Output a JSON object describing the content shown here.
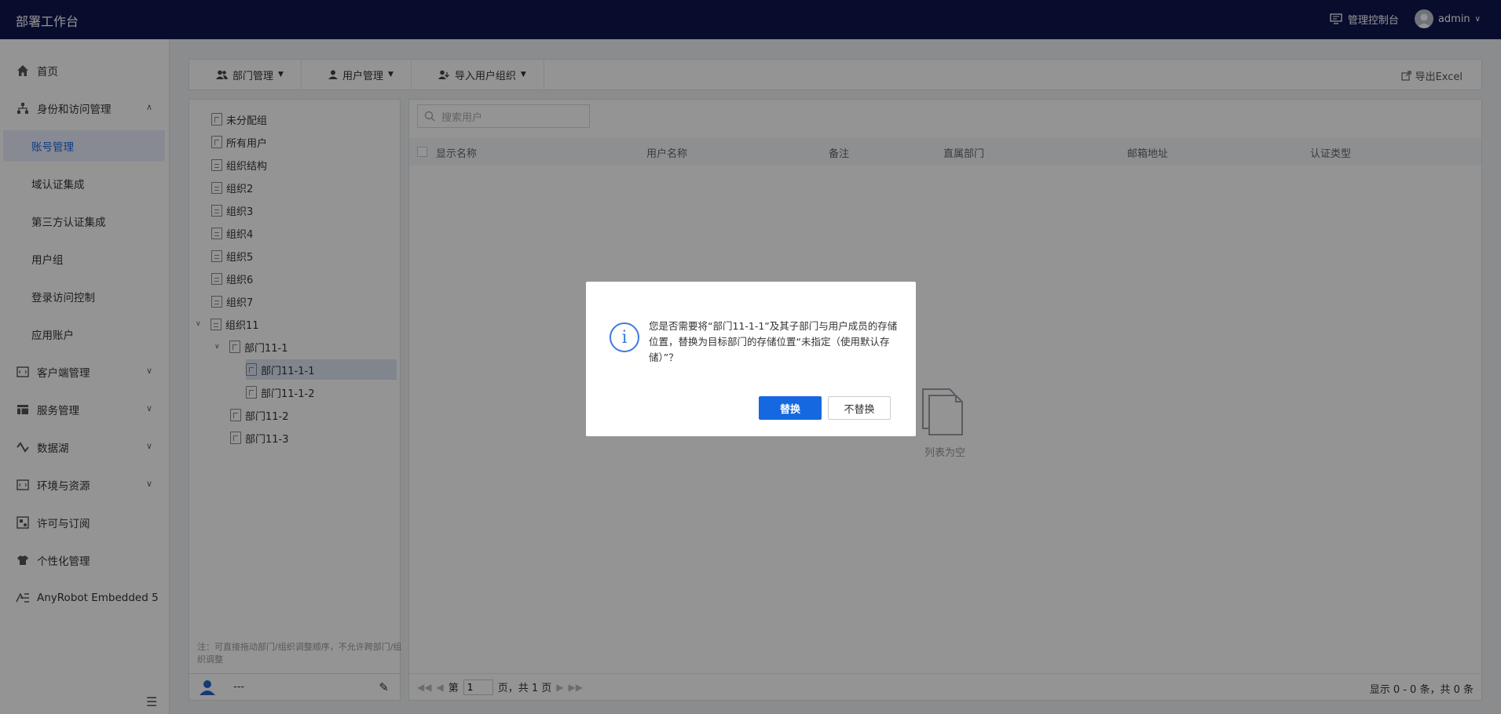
{
  "header": {
    "title": "部署工作台",
    "console_label": "管理控制台",
    "user_name": "admin"
  },
  "sidebar": {
    "items": [
      {
        "label": "首页",
        "icon": "home-icon"
      },
      {
        "label": "身份和访问管理",
        "icon": "org-icon",
        "expanded": true
      },
      {
        "label": "账号管理",
        "sub": true,
        "active": true
      },
      {
        "label": "域认证集成",
        "sub": true
      },
      {
        "label": "第三方认证集成",
        "sub": true
      },
      {
        "label": "用户组",
        "sub": true
      },
      {
        "label": "登录访问控制",
        "sub": true
      },
      {
        "label": "应用账户",
        "sub": true
      },
      {
        "label": "客户端管理",
        "icon": "client-icon"
      },
      {
        "label": "服务管理",
        "icon": "service-icon"
      },
      {
        "label": "数据湖",
        "icon": "datalake-icon"
      },
      {
        "label": "环境与资源",
        "icon": "env-icon"
      },
      {
        "label": "许可与订阅",
        "icon": "license-icon"
      },
      {
        "label": "个性化管理",
        "icon": "shirt-icon"
      },
      {
        "label": "AnyRobot Embedded 5",
        "icon": "anyrobot-icon"
      }
    ]
  },
  "toolbar": {
    "dept_mgmt": "部门管理",
    "user_mgmt": "用户管理",
    "import_org": "导入用户组织",
    "export_excel": "导出Excel"
  },
  "tree": {
    "nodes": [
      {
        "label": "未分配组",
        "type": "doc"
      },
      {
        "label": "所有用户",
        "type": "doc"
      },
      {
        "label": "组织结构",
        "type": "org"
      },
      {
        "label": "组织2",
        "type": "org"
      },
      {
        "label": "组织3",
        "type": "org"
      },
      {
        "label": "组织4",
        "type": "org"
      },
      {
        "label": "组织5",
        "type": "org"
      },
      {
        "label": "组织6",
        "type": "org"
      },
      {
        "label": "组织7",
        "type": "org"
      },
      {
        "label": "组织11",
        "type": "org",
        "expanded": true
      },
      {
        "label": "部门11-1",
        "type": "doc",
        "expanded": true
      },
      {
        "label": "部门11-1-1",
        "type": "doc",
        "selected": true
      },
      {
        "label": "部门11-1-2",
        "type": "doc"
      },
      {
        "label": "部门11-2",
        "type": "doc"
      },
      {
        "label": "部门11-3",
        "type": "doc"
      }
    ],
    "note": "注：可直接拖动部门/组织调整顺序，不允许跨部门/组织调整",
    "footer_text": "---"
  },
  "user_list": {
    "search_placeholder": "搜索用户",
    "columns": [
      "显示名称",
      "用户名称",
      "备注",
      "直属部门",
      "邮箱地址",
      "认证类型"
    ],
    "empty_text": "列表为空",
    "pager": {
      "prefix": "第",
      "page": "1",
      "suffix": "页，共 1 页",
      "summary": "显示 0 - 0 条，共 0 条"
    }
  },
  "dialog": {
    "message": "您是否需要将“部门11-1-1”及其子部门与用户成员的存储位置，替换为目标部门的存储位置“未指定（使用默认存储）”？",
    "confirm_label": "替换",
    "cancel_label": "不替换"
  },
  "colors": {
    "topbar": "#0f1750",
    "primary": "#1568e0",
    "active_bg": "#e8eefc"
  }
}
